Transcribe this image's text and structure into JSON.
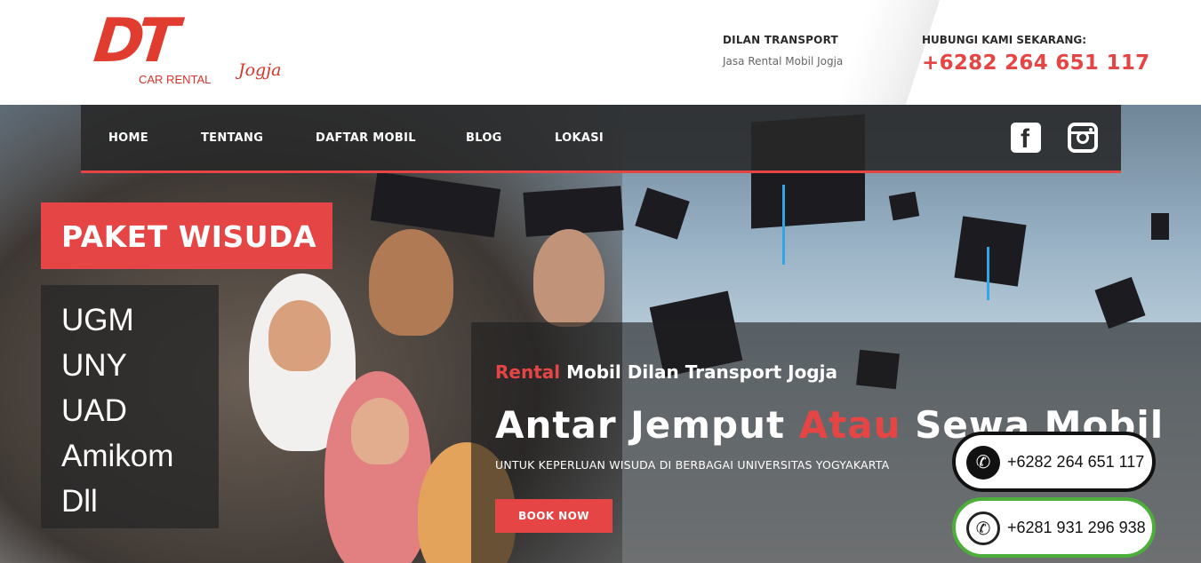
{
  "header": {
    "logo": {
      "mark": "DT",
      "sub": "CAR RENTAL",
      "script": "Jogja"
    },
    "brand_name": "DILAN TRANSPORT",
    "brand_tagline": "Jasa Rental Mobil Jogja",
    "contact_label": "HUBUNGI KAMI SEKARANG:",
    "contact_phone": "+6282 264 651 117"
  },
  "nav": {
    "items": [
      {
        "label": "HOME"
      },
      {
        "label": "TENTANG"
      },
      {
        "label": "DAFTAR MOBIL"
      },
      {
        "label": "BLOG"
      },
      {
        "label": "LOKASI"
      }
    ],
    "social": [
      {
        "icon": "facebook-icon"
      },
      {
        "icon": "instagram-icon"
      }
    ]
  },
  "promo": {
    "title": "PAKET WISUDA",
    "universities": [
      "UGM",
      "UNY",
      "UAD",
      "Amikom",
      "Dll"
    ]
  },
  "hero": {
    "subtitle_highlight": "Rental",
    "subtitle_rest": " Mobil Dilan Transport Jogja",
    "headline_part1": "Antar Jemput ",
    "headline_highlight": "Atau",
    "headline_part2": " Sewa Mobil",
    "caption": "UNTUK KEPERLUAN WISUDA DI BERBAGAI UNIVERSITAS YOGYAKARTA",
    "cta_label": "BOOK NOW"
  },
  "floating": {
    "call_number": "+6282 264 651 117",
    "whatsapp_number": "+6281 931 296 938"
  },
  "colors": {
    "accent": "#e64545",
    "whatsapp": "#4caf3a",
    "dark": "#282828"
  }
}
